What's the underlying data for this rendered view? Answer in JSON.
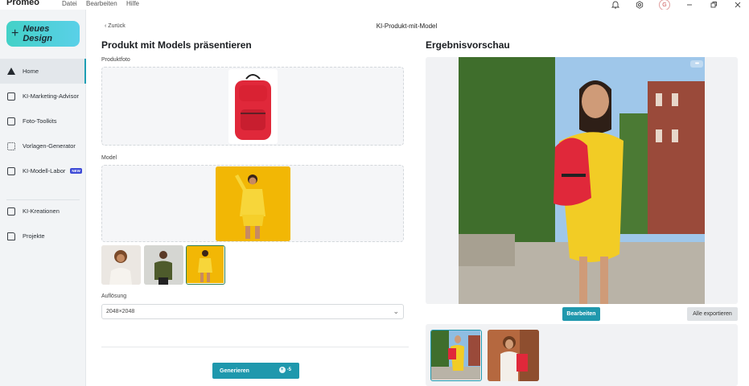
{
  "app": {
    "brand": "Promeo",
    "menu": [
      "Datei",
      "Bearbeiten",
      "Hilfe"
    ],
    "avatar_letter": "G"
  },
  "sidebar": {
    "new_design_label": "Neues Design",
    "items": [
      {
        "label": "Home",
        "icon": "home-icon",
        "active": true
      },
      {
        "label": "KI-Marketing-Advisor",
        "icon": "advisor-icon"
      },
      {
        "label": "Foto-Toolkits",
        "icon": "image-icon"
      },
      {
        "label": "Vorlagen-Generator",
        "icon": "grid-icon"
      },
      {
        "label": "KI-Modell-Labor",
        "icon": "lab-icon",
        "badge": "NEW"
      },
      {
        "label": "KI-Kreationen",
        "icon": "creations-icon"
      },
      {
        "label": "Projekte",
        "icon": "folder-icon"
      }
    ]
  },
  "header": {
    "back_label": "Zurück",
    "title": "KI-Produkt-mit-Model"
  },
  "left": {
    "heading": "Produkt mit Models präsentieren",
    "product_label": "Produktfoto",
    "model_label": "Model",
    "resolution_label": "Auflösung",
    "resolution_value": "2048×2048",
    "generate_label": "Generieren",
    "generate_cost": "-5"
  },
  "right": {
    "heading": "Ergebnisvorschau",
    "edit_label": "Bearbeiten",
    "export_label": "Alle exportieren",
    "more_label": "•••"
  },
  "colors": {
    "accent": "#1f98ad",
    "backpack_red": "#e0283a",
    "model_yellow": "#f2b705",
    "badge_new": "#3d4ad6"
  }
}
